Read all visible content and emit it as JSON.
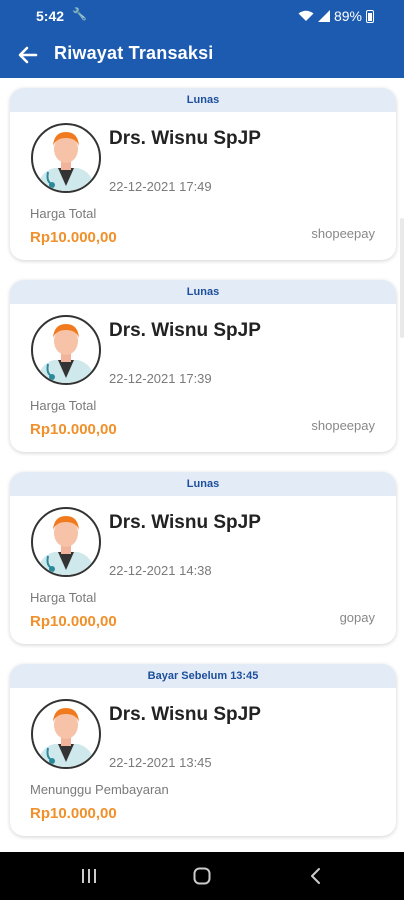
{
  "status_bar": {
    "time": "5:42",
    "battery": "89%"
  },
  "app_bar": {
    "title": "Riwayat Transaksi"
  },
  "transactions": [
    {
      "status": "Lunas",
      "doctor": "Drs. Wisnu SpJP",
      "datetime": "22-12-2021 17:49",
      "price_label": "Harga Total",
      "price": "Rp10.000,00",
      "payment_method": "shopeepay"
    },
    {
      "status": "Lunas",
      "doctor": "Drs. Wisnu SpJP",
      "datetime": "22-12-2021 17:39",
      "price_label": "Harga Total",
      "price": "Rp10.000,00",
      "payment_method": "shopeepay"
    },
    {
      "status": "Lunas",
      "doctor": "Drs. Wisnu SpJP",
      "datetime": "22-12-2021 14:38",
      "price_label": "Harga Total",
      "price": "Rp10.000,00",
      "payment_method": "gopay"
    },
    {
      "status": "Bayar Sebelum 13:45",
      "doctor": "Drs. Wisnu SpJP",
      "datetime": "22-12-2021 13:45",
      "price_label": "Menunggu Pembayaran",
      "price": "Rp10.000,00",
      "payment_method": ""
    }
  ],
  "colors": {
    "primary": "#1d5bb0",
    "header_tint": "#e3ebf6",
    "price": "#f0902a"
  },
  "icons": {
    "back": "arrow-left-icon",
    "avatar": "doctor-avatar-icon"
  }
}
